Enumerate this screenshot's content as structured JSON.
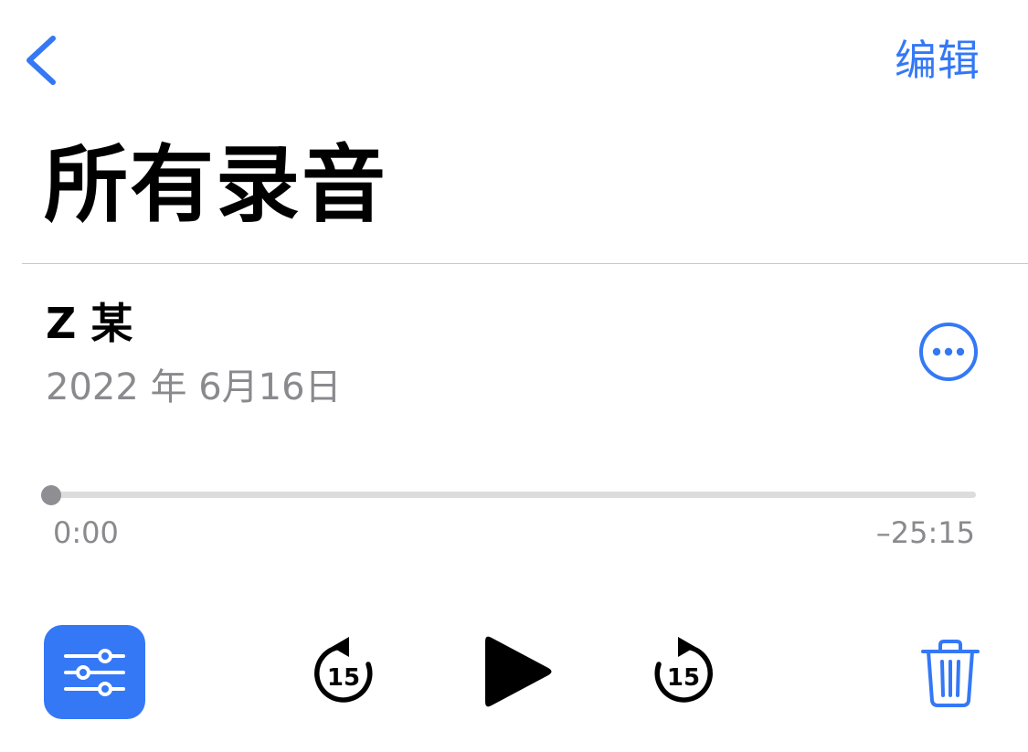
{
  "nav": {
    "edit_label": "编辑",
    "back_icon": "chevron-left-icon"
  },
  "page": {
    "title": "所有录音"
  },
  "recording": {
    "name": "Z 某",
    "date": "2022 年 6月16日",
    "more_icon": "ellipsis-circle-icon"
  },
  "playback": {
    "progress_fraction": 0,
    "elapsed": "0:00",
    "remaining": "–25:15"
  },
  "controls": {
    "skip_back_label": "15",
    "skip_forward_label": "15",
    "options_icon": "sliders-icon",
    "skip_back_icon": "skip-back-15-icon",
    "play_icon": "play-icon",
    "skip_forward_icon": "skip-forward-15-icon",
    "delete_icon": "trash-icon"
  },
  "colors": {
    "accent": "#3478f6",
    "secondary_text": "#8a8a8e",
    "track": "#dcdcdc",
    "knob": "#8e8e93"
  }
}
